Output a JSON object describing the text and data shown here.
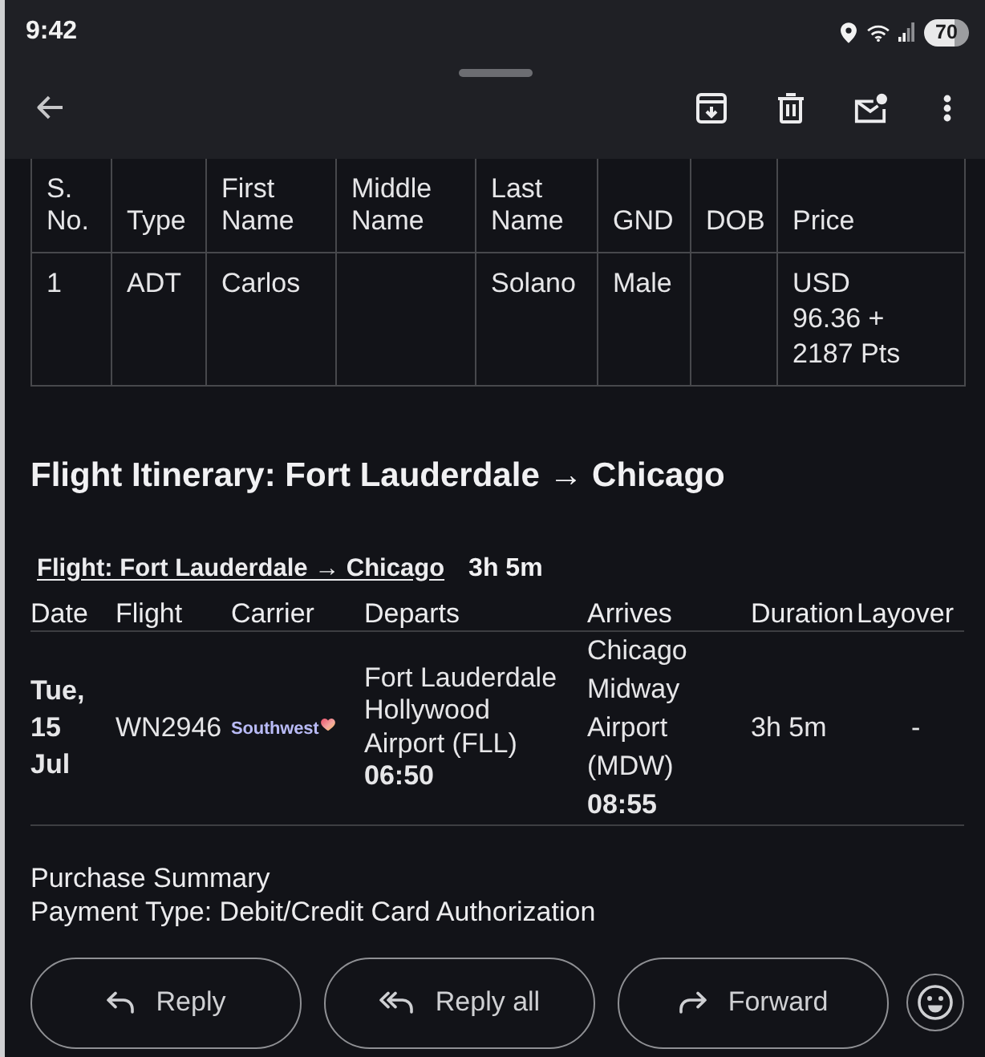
{
  "status_bar": {
    "time": "9:42",
    "battery": "70"
  },
  "passenger_table": {
    "columns": [
      "S. No.",
      "Type",
      "First Name",
      "Middle Name",
      "Last Name",
      "GND",
      "DOB",
      "Price"
    ],
    "rows": [
      {
        "cells": [
          "1",
          "ADT",
          "Carlos",
          null,
          "Solano",
          "Male",
          null,
          "USD 96.36 + 2187 Pts"
        ]
      }
    ]
  },
  "itinerary": {
    "title": "Flight Itinerary: Fort Lauderdale → Chicago",
    "segment": {
      "route": "Flight: Fort Lauderdale → Chicago",
      "duration": "3h 5m"
    },
    "columns": [
      "Date",
      "Flight",
      "Carrier",
      "Departs",
      "Arrives",
      "Duration",
      "Layover"
    ],
    "flights": [
      {
        "date": "Tue, 15 Jul",
        "flight": "WN2946",
        "carrier": "Southwest",
        "departs": {
          "airport": "Fort Lauderdale Hollywood Airport (FLL)",
          "time": "06:50"
        },
        "arrives": {
          "airport": "Chicago Midway Airport (MDW)",
          "time": "08:55"
        },
        "duration": "3h 5m",
        "layover": "-"
      }
    ]
  },
  "purchase_summary": {
    "title": "Purchase Summary",
    "payment_type": "Payment Type: Debit/Credit Card Authorization"
  },
  "actions": [
    {
      "kind": "reply",
      "label": "Reply"
    },
    {
      "kind": "reply_all",
      "label": "Reply all"
    },
    {
      "kind": "forward",
      "label": "Forward"
    }
  ]
}
